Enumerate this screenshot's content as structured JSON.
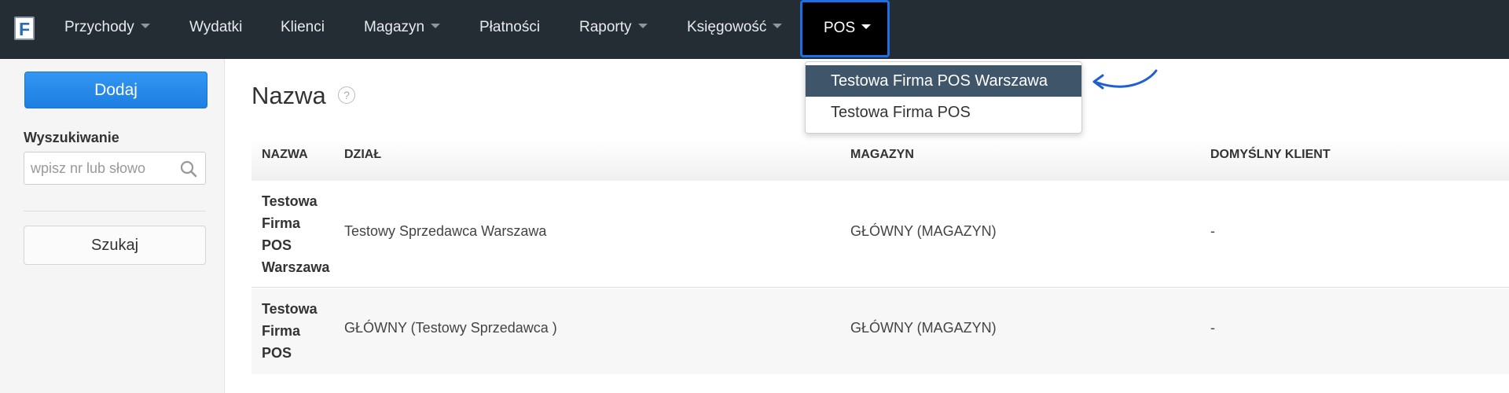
{
  "nav": {
    "logo_letter": "F",
    "items": [
      {
        "label": "Przychody",
        "caret": true
      },
      {
        "label": "Wydatki",
        "caret": false
      },
      {
        "label": "Klienci",
        "caret": false
      },
      {
        "label": "Magazyn",
        "caret": true
      },
      {
        "label": "Płatności",
        "caret": false
      },
      {
        "label": "Raporty",
        "caret": true
      },
      {
        "label": "Księgowość",
        "caret": true
      }
    ],
    "active_item": "POS"
  },
  "dropdown": {
    "items": [
      "Testowa Firma POS Warszawa",
      "Testowa Firma POS"
    ],
    "highlighted_index": 0
  },
  "sidebar": {
    "add_button": "Dodaj",
    "search_label": "Wyszukiwanie",
    "search_placeholder": "wpisz nr lub słowo",
    "search_button": "Szukaj"
  },
  "main": {
    "title": "Nazwa",
    "help_glyph": "?",
    "columns": [
      "NAZWA",
      "DZIAŁ",
      "MAGAZYN",
      "DOMYŚLNY KLIENT"
    ],
    "rows": [
      {
        "name_lines": [
          "Testowa",
          "Firma",
          "POS",
          "Warszawa"
        ],
        "dzial": "Testowy Sprzedawca Warszawa",
        "magazyn": "GŁÓWNY (MAGAZYN)",
        "klient": "-"
      },
      {
        "name_lines": [
          "Testowa",
          "Firma",
          "POS"
        ],
        "dzial": "GŁÓWNY (Testowy Sprzedawca )",
        "magazyn": "GŁÓWNY (MAGAZYN)",
        "klient": "-"
      }
    ]
  },
  "colors": {
    "navbar_bg": "#252d34",
    "highlight_border": "#1c6fe5",
    "primary_button": "#1d7fe0",
    "dropdown_active_bg": "#3f5569"
  }
}
